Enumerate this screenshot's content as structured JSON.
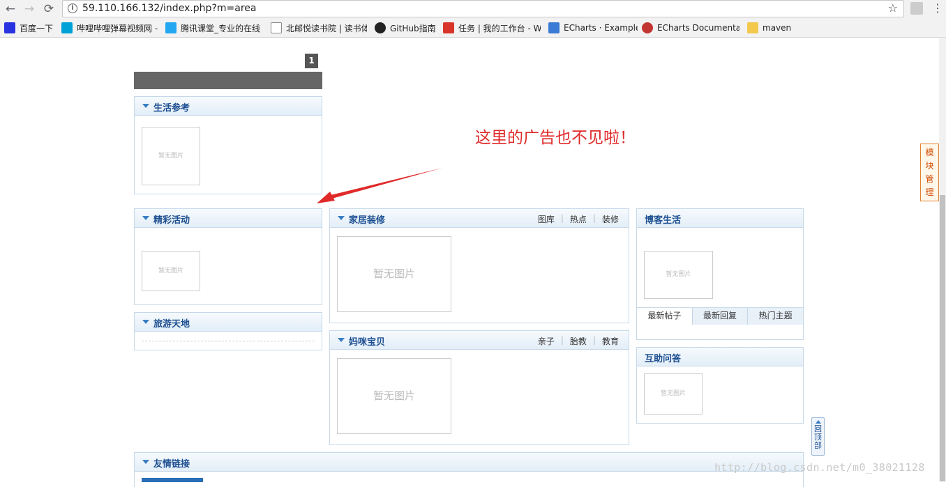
{
  "browser": {
    "url": "59.110.166.132/index.php?m=area",
    "back_icon": "arrow-left-icon",
    "forward_icon": "arrow-right-icon",
    "reload_icon": "reload-icon",
    "star_icon": "star-icon"
  },
  "bookmarks": [
    {
      "label": "百度一下",
      "color": "#2932e1"
    },
    {
      "label": "哔哩哔哩弹幕视频网 -",
      "color": "#00a1d6"
    },
    {
      "label": "腾讯课堂_专业的在线",
      "color": "#22a7f0"
    },
    {
      "label": "北邮悦读书院 | 读书体",
      "color": "#888888"
    },
    {
      "label": "GitHub指南",
      "color": "#222222"
    },
    {
      "label": "任务 | 我的工作台 - W",
      "color": "#d9342b"
    },
    {
      "label": "ECharts · Example",
      "color": "#3a7bd5"
    },
    {
      "label": "ECharts Documentat",
      "color": "#c23531"
    },
    {
      "label": "maven",
      "color": "#f2c94c"
    }
  ],
  "page": {
    "pager_number": "1",
    "annotation": "这里的广告也不见啦！",
    "float_button": [
      "模",
      "块",
      "管",
      "理"
    ],
    "back_to_top": [
      "回",
      "顶",
      "部"
    ],
    "watermark": "http://blog.csdn.net/m0_38021128"
  },
  "panels": {
    "life": {
      "title": "生活参考",
      "noimg": "暂无图片"
    },
    "events": {
      "title": "精彩活动",
      "noimg": "暂无图片"
    },
    "travel": {
      "title": "旅游天地"
    },
    "home": {
      "title": "家居装修",
      "links": [
        "图库",
        "热点",
        "装修"
      ],
      "noimg": "暂无图片"
    },
    "baby": {
      "title": "妈咪宝贝",
      "links": [
        "亲子",
        "胎教",
        "教育"
      ],
      "noimg": "暂无图片"
    },
    "blog": {
      "title": "博客生活",
      "noimg": "暂无图片",
      "tabs": [
        "最新帖子",
        "最新回复",
        "热门主题"
      ]
    },
    "qa": {
      "title": "互助问答",
      "noimg": "暂无图片"
    },
    "links": {
      "title": "友情链接"
    }
  }
}
